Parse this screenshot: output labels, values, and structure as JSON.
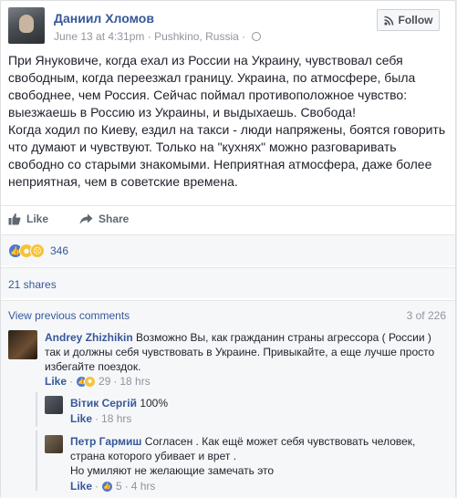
{
  "post": {
    "author": "Даниил Хломов",
    "meta": "June 13 at 4:31pm · Pushkino, Russia ·",
    "follow_label": "Follow",
    "text": "При Януковиче, когда ехал из России на Украину, чувствовал себя свободным, когда переезжал границу. Украина, по атмосфере, была свободнее, чем Россия. Сейчас поймал противоположное чувство: выезжаешь в Россию из Украины, и выдыхаешь. Свобода!\nКогда ходил по Киеву, ездил на такси - люди напряжены, боятся говорить что думают и чувствуют. Только на \"кухнях\" можно разговаривать свободно со старыми знакомыми. Неприятная атмосфера, даже более неприятная, чем в советские времена."
  },
  "actions": {
    "like_label": "Like",
    "share_label": "Share"
  },
  "reactions": {
    "count": "346"
  },
  "shares": {
    "label": "21 shares"
  },
  "comments": {
    "view_previous": "View previous comments",
    "counter": "3 of 226",
    "items": [
      {
        "name": "Andrey Zhizhikin",
        "text": "Возможно Вы, как гражданин страны агрессора ( России ) так и должны себя чувствовать в Украине. Привыкайте, а еще лучше просто избегайте поездок.",
        "like": "Like",
        "count": "29",
        "time": "18 hrs"
      },
      {
        "name": "Вiтик Сергій",
        "text": "100%",
        "like": "Like",
        "time": "18 hrs"
      },
      {
        "name": "Петр Гармиш",
        "text": "Согласен . Как ещё может себя чувствовать человек, страна которого убивает и врет .\nНо умиляют не желающие замечать это",
        "like": "Like",
        "count": "5",
        "time": "4 hrs"
      }
    ]
  }
}
